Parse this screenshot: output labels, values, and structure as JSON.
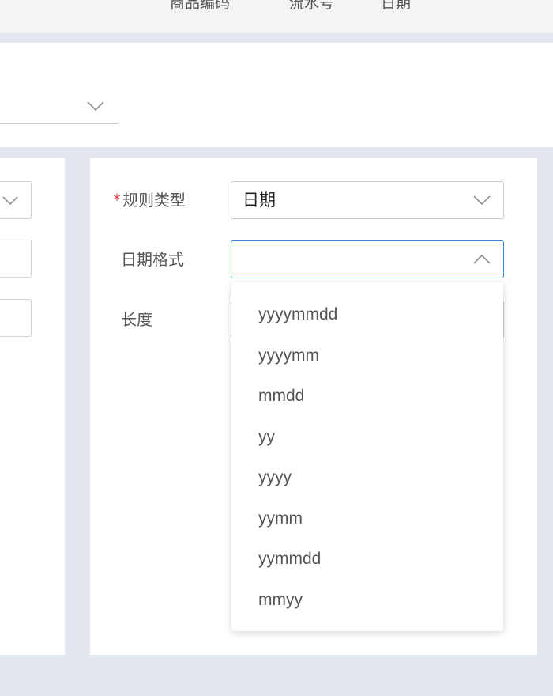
{
  "top_tabs": [
    "商品编码",
    "流水号",
    "日期"
  ],
  "form": {
    "rule_type": {
      "required_mark": "*",
      "label": "规则类型",
      "value": "日期"
    },
    "date_format": {
      "label": "日期格式",
      "value": ""
    },
    "length": {
      "label": "长度"
    }
  },
  "dropdown": {
    "options": [
      "yyyymmdd",
      "yyyymm",
      "mmdd",
      "yy",
      "yyyy",
      "yymm",
      "yymmdd",
      "mmyy"
    ]
  },
  "colors": {
    "background": "#e3e7ef",
    "accent_border": "#3a86d8",
    "required": "#e04545"
  }
}
